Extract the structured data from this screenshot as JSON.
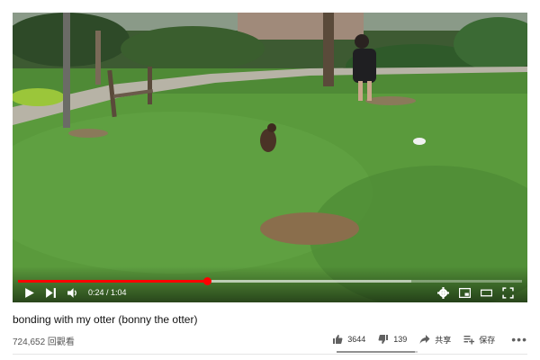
{
  "player": {
    "time_current": "0:24",
    "time_total": "1:04",
    "time_display": "0:24 / 1:04",
    "played_fraction": 0.375,
    "buffered_fraction": 0.78,
    "accent_color": "#ff0000"
  },
  "video": {
    "title": "bonding with my otter (bonny the otter)",
    "view_count": "724,652 回觀看"
  },
  "actions": {
    "like_count": "3644",
    "dislike_count": "139",
    "share_label": "共享",
    "save_label": "保存",
    "more_label": "•••",
    "like_ratio": 0.963
  },
  "icons": [
    "play-icon",
    "next-icon",
    "volume-icon",
    "settings-icon",
    "miniplayer-icon",
    "theater-icon",
    "fullscreen-icon",
    "thumbs-up-icon",
    "thumbs-down-icon",
    "share-icon",
    "save-icon"
  ]
}
